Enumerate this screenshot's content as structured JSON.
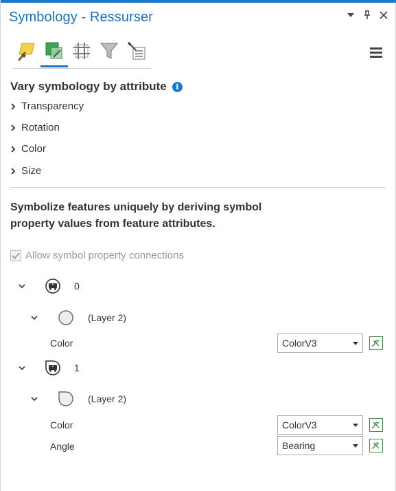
{
  "pane": {
    "title": "Symbology - Ressurser",
    "controls": [
      "menu-down-icon",
      "pin-icon",
      "close-icon"
    ],
    "accent_color": "#1e78c8"
  },
  "toolbar": {
    "tools": [
      {
        "name": "primary-symbology",
        "icon": "paintbrush-icon"
      },
      {
        "name": "vary-symbology",
        "icon": "vary-symbology-icon",
        "active": true
      },
      {
        "name": "symbol-layer-drawing",
        "icon": "grid-icon"
      },
      {
        "name": "filter",
        "icon": "funnel-icon"
      },
      {
        "name": "properties",
        "icon": "list-brush-icon"
      }
    ]
  },
  "vary": {
    "title": "Vary symbology by attribute",
    "items": [
      "Transparency",
      "Rotation",
      "Color",
      "Size"
    ]
  },
  "derive": {
    "description": "Symbolize features uniquely by deriving symbol property values from feature attributes.",
    "checkbox_label": "Allow symbol property connections",
    "checked": true
  },
  "symbols": [
    {
      "label": "0",
      "layer": {
        "label": "(Layer 2)",
        "shape": "circle"
      },
      "properties": [
        {
          "label": "Color",
          "value": "ColorV3"
        }
      ]
    },
    {
      "label": "1",
      "layer": {
        "label": "(Layer 2)",
        "shape": "teardrop"
      },
      "properties": [
        {
          "label": "Color",
          "value": "ColorV3"
        },
        {
          "label": "Angle",
          "value": "Bearing"
        }
      ]
    }
  ]
}
